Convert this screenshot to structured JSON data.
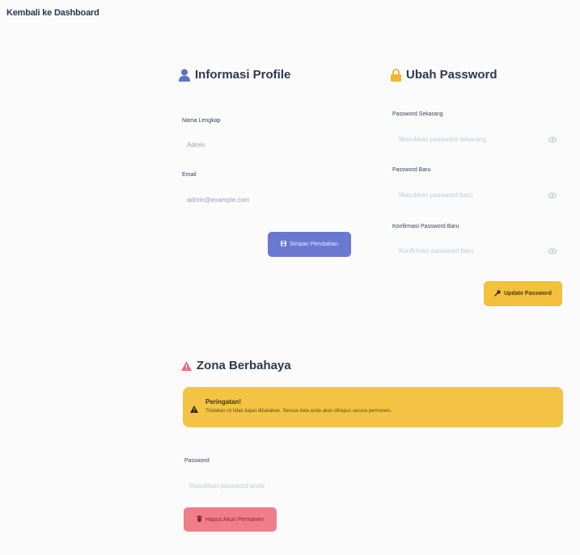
{
  "nav": {
    "back_label": "Kembali ke Dashboard"
  },
  "profile": {
    "title": "Informasi Profile",
    "name_label": "Nama Lengkap",
    "name_value": "Admin",
    "email_label": "Email",
    "email_value": "admin@example.com",
    "save_button": "Simpan Perubahan",
    "accent_color": "#6a78d1"
  },
  "password": {
    "title": "Ubah Password",
    "current_label": "Password Sekarang",
    "current_placeholder": "Masukkan password sekarang",
    "new_label": "Password Baru",
    "new_placeholder": "Masukkan password baru",
    "confirm_label": "Konfirmasi Password Baru",
    "confirm_placeholder": "Konfirmasi password baru",
    "update_button": "Update Password",
    "accent_color": "#f3bf3c"
  },
  "danger": {
    "title": "Zona Berbahaya",
    "warning_title": "Peringatan!",
    "warning_text": "Tindakan ini tidak dapat dibatalkan. Semua data anda akan dihapus secara permanen.",
    "password_label": "Password",
    "password_placeholder": "Masukkan password anda",
    "delete_button": "Hapus Akun Permanen",
    "accent_color": "#f07e8a",
    "warning_color": "#f4c343"
  },
  "icons": {
    "profile": "user-icon",
    "password": "lock-icon",
    "danger": "warning-triangle-icon",
    "save": "floppy-disk-icon",
    "update": "key-icon",
    "delete": "trash-icon",
    "visibility": "eye-icon"
  }
}
